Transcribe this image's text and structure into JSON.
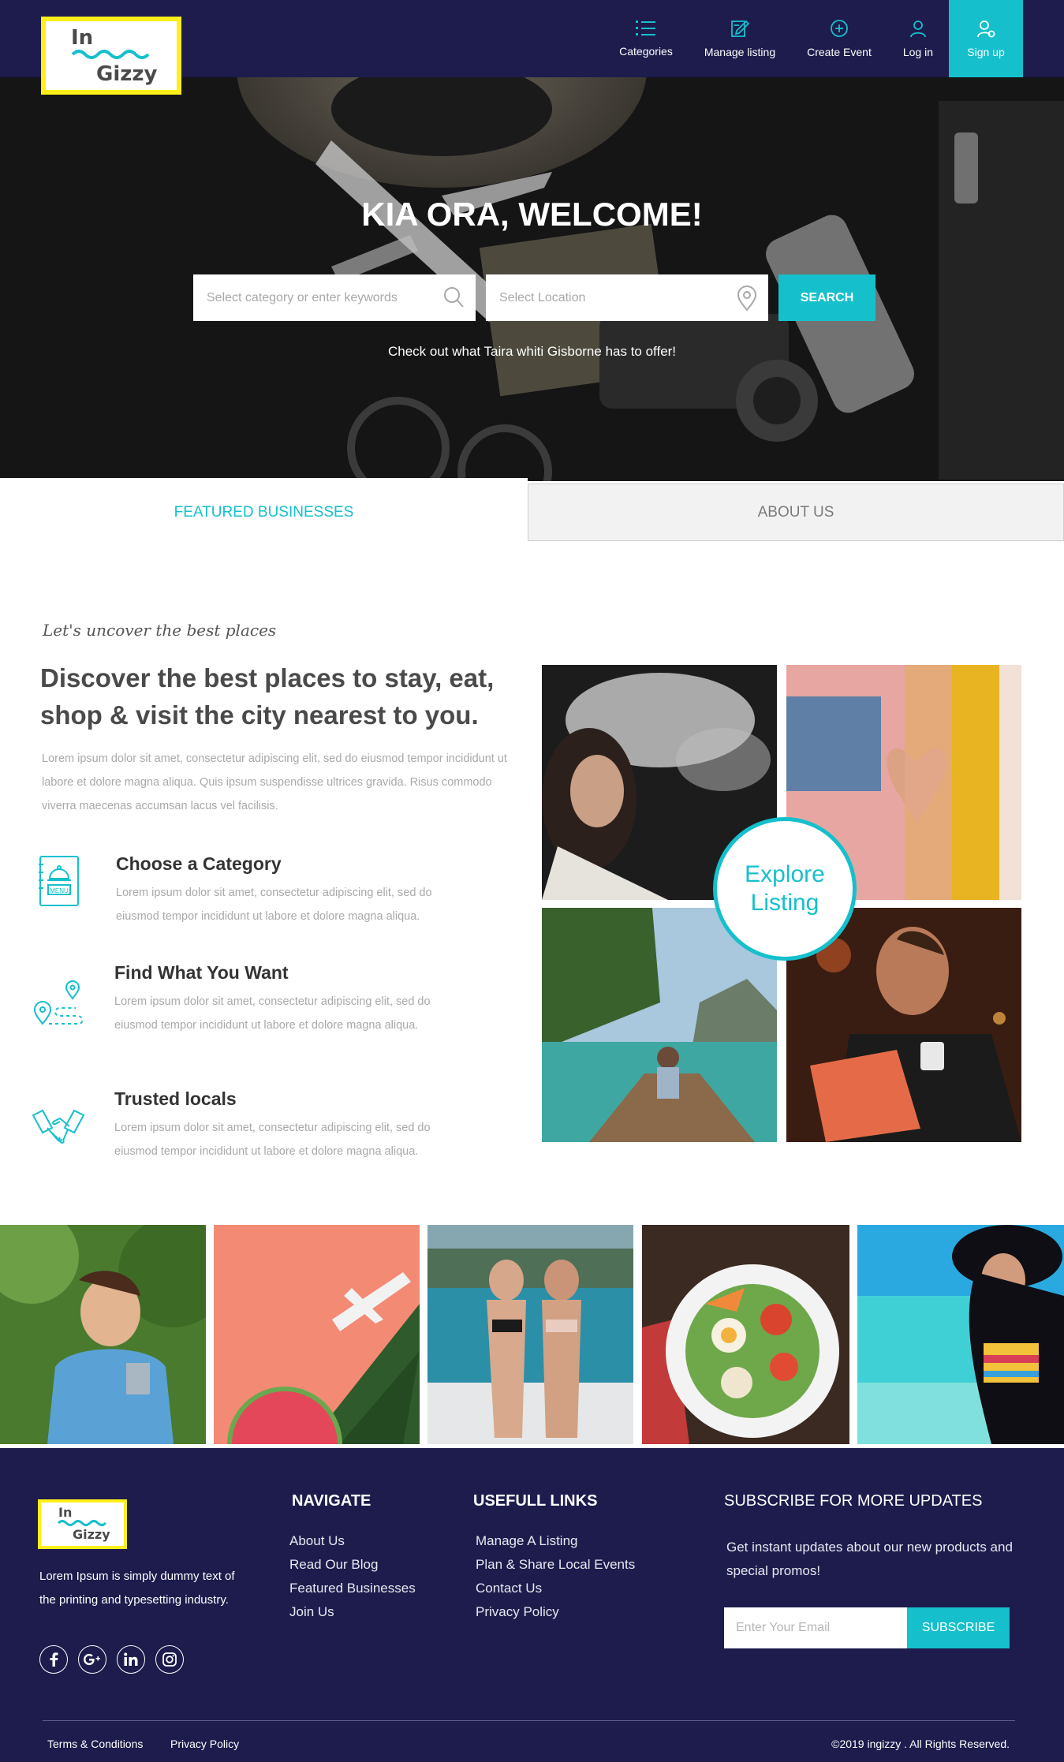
{
  "brand": {
    "logo_line1": "In",
    "logo_line2": "Gizzy",
    "accent_color": "#15c0cc",
    "navy_color": "#1d1c4d",
    "logo_frame_color": "#ffef1a"
  },
  "nav": {
    "items": [
      {
        "label": "Categories",
        "icon": "list-icon"
      },
      {
        "label": "Manage listing",
        "icon": "edit-icon"
      },
      {
        "label": "Create Event",
        "icon": "plus-circle-icon"
      },
      {
        "label": "Log in",
        "icon": "user-icon"
      },
      {
        "label": "Sign up",
        "icon": "user-plus-icon"
      }
    ]
  },
  "hero": {
    "title": "KIA ORA, WELCOME!",
    "keyword_placeholder": "Select category or enter keywords",
    "location_placeholder": "Select Location",
    "search_label": "SEARCH",
    "subtitle": "Check out what Taira whiti Gisborne has to offer!"
  },
  "tabs": {
    "featured": "FEATURED BUSINESSES",
    "about": "ABOUT US"
  },
  "discover": {
    "tagline": "Let's uncover the best places",
    "title": "Discover the best places to stay, eat, shop & visit the city nearest to you.",
    "description": "Lorem ipsum dolor sit amet, consectetur adipiscing elit, sed do eiusmod tempor incididunt ut labore et dolore magna aliqua. Quis ipsum suspendisse ultrices gravida. Risus commodo viverra maecenas accumsan lacus vel facilisis.",
    "features": [
      {
        "title": "Choose a Category",
        "desc": "Lorem ipsum dolor sit amet, consectetur adipiscing elit, sed do eiusmod tempor incididunt ut labore et dolore magna aliqua.",
        "icon": "menu-icon"
      },
      {
        "title": "Find What You Want",
        "desc": "Lorem ipsum dolor sit amet, consectetur adipiscing elit, sed do eiusmod tempor incididunt ut labore et dolore magna aliqua.",
        "icon": "map-route-icon"
      },
      {
        "title": "Trusted locals",
        "desc": "Lorem ipsum dolor sit amet, consectetur adipiscing elit, sed do eiusmod tempor incididunt ut labore et dolore magna aliqua.",
        "icon": "handshake-icon"
      }
    ],
    "explore_line1": "Explore",
    "explore_line2": "Listing"
  },
  "footer": {
    "about": "Lorem Ipsum is simply dummy text of the printing and typesetting industry.",
    "navigate_heading": "NAVIGATE",
    "navigate_links": [
      "About Us",
      "Read Our Blog",
      "Featured Businesses",
      "Join Us"
    ],
    "useful_heading": "USEFULL LINKS",
    "useful_links": [
      "Manage A Listing",
      "Plan & Share Local Events",
      "Contact Us",
      "Privacy Policy"
    ],
    "subscribe_heading": "SUBSCRIBE FOR MORE UPDATES",
    "subscribe_desc": "Get instant updates about our new products and special promos!",
    "email_placeholder": "Enter Your Email",
    "subscribe_label": "SUBSCRIBE",
    "terms": "Terms & Conditions",
    "privacy": "Privacy Policy",
    "copyright": "©2019 ingizzy . All Rights Reserved.",
    "social": [
      "facebook-icon",
      "google-plus-icon",
      "linkedin-icon",
      "instagram-icon"
    ]
  }
}
